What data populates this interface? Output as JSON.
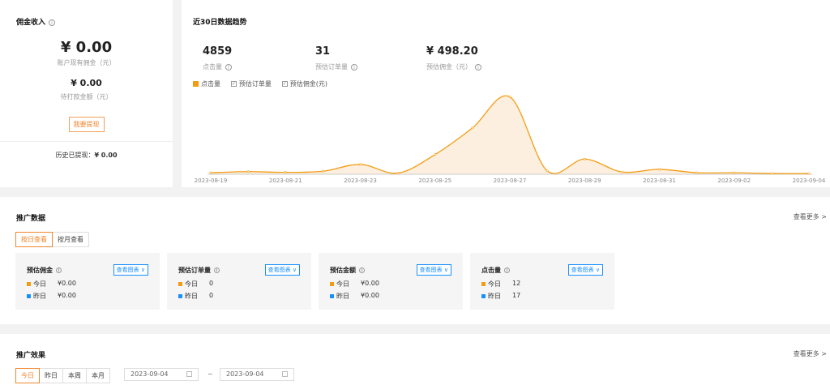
{
  "commission": {
    "title": "佣金收入",
    "current_amount": "¥ 0.00",
    "current_label": "账户现有佣金（元）",
    "pending_amount": "¥ 0.00",
    "pending_label": "待打款金额（元）",
    "withdraw_button": "我要提现",
    "history_label": "历史已提现：",
    "history_amount": "¥ 0.00"
  },
  "trend": {
    "title": "近30日数据趋势",
    "metrics": [
      {
        "value": "4859",
        "label": "点击量"
      },
      {
        "value": "31",
        "label": "预估订单量"
      },
      {
        "value": "¥ 498.20",
        "label": "预估佣金（元）"
      }
    ],
    "legend": [
      {
        "label": "点击量",
        "checked": true,
        "color": "#f39c12"
      },
      {
        "label": "预估订单量",
        "checked": false
      },
      {
        "label": "预估佣金(元)",
        "checked": false
      }
    ]
  },
  "chart_data": {
    "type": "area",
    "title": "",
    "xlabel": "",
    "ylabel": "",
    "x": [
      "2023-08-19",
      "2023-08-20",
      "2023-08-21",
      "2023-08-22",
      "2023-08-23",
      "2023-08-24",
      "2023-08-25",
      "2023-08-26",
      "2023-08-27",
      "2023-08-28",
      "2023-08-29",
      "2023-08-30",
      "2023-08-31",
      "2023-09-01",
      "2023-09-02",
      "2023-09-03",
      "2023-09-04"
    ],
    "tick_labels": [
      "2023-08-19",
      "2023-08-21",
      "2023-08-23",
      "2023-08-25",
      "2023-08-27",
      "2023-08-29",
      "2023-08-31",
      "2023-09-02",
      "2023-09-04"
    ],
    "series": [
      {
        "name": "点击量",
        "color": "#f39c12",
        "values": [
          40,
          70,
          50,
          80,
          260,
          30,
          520,
          1220,
          2040,
          90,
          400,
          60,
          130,
          40,
          40,
          20,
          20
        ]
      }
    ],
    "ylim": [
      0,
      2200
    ],
    "grid": false
  },
  "promo": {
    "title": "推广数据",
    "more": "查看更多 >",
    "tabs": [
      "按日查看",
      "按月查看"
    ],
    "cards": [
      {
        "title": "预估佣金",
        "chip": "查看图表 ∨",
        "today_label": "今日",
        "today": "¥0.00",
        "yesterday_label": "昨日",
        "yesterday": "¥0.00"
      },
      {
        "title": "预估订单量",
        "chip": "查看图表 ∨",
        "today_label": "今日",
        "today": "0",
        "yesterday_label": "昨日",
        "yesterday": "0"
      },
      {
        "title": "预估金额",
        "chip": "查看图表 ∨",
        "today_label": "今日",
        "today": "¥0.00",
        "yesterday_label": "昨日",
        "yesterday": "¥0.00"
      },
      {
        "title": "点击量",
        "chip": "查看图表 ∨",
        "today_label": "今日",
        "today": "12",
        "yesterday_label": "昨日",
        "yesterday": "17"
      }
    ],
    "today_color": "#f39c12",
    "yesterday_color": "#1890ff"
  },
  "effect": {
    "title": "推广效果",
    "more": "查看更多 >",
    "tabs": [
      "今日",
      "昨日",
      "本周",
      "本月"
    ],
    "date_from": "2023-09-04",
    "date_sep": "~",
    "date_to": "2023-09-04"
  }
}
